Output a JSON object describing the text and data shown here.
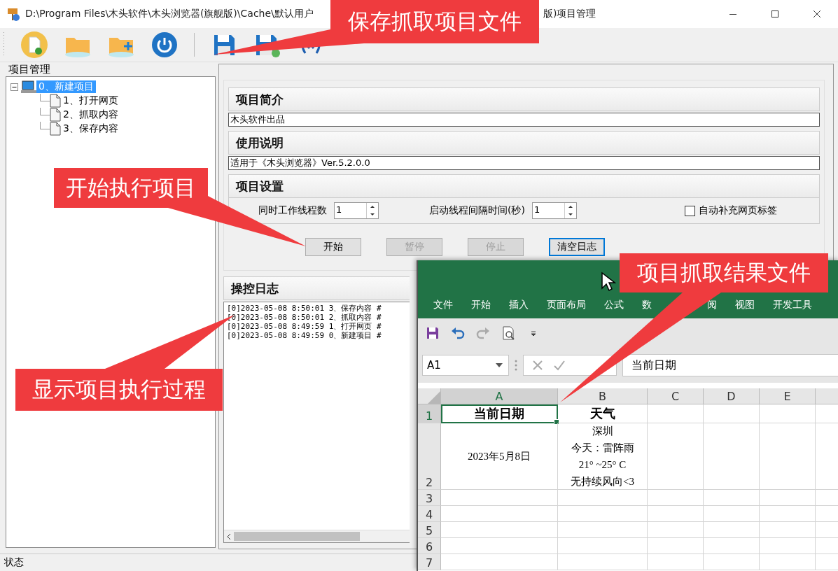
{
  "window": {
    "title_start": "D:\\Program Files\\木头软件\\木头浏览器(旗舰版)\\Cache\\默认用户",
    "title_end": "版)项目管理"
  },
  "project_panel": {
    "title": "项目管理",
    "tree": [
      {
        "label": "0、新建项目",
        "selected": true,
        "expanded": true,
        "children": [
          {
            "label": "1、打开网页",
            "selected": false
          },
          {
            "label": "2、抓取内容",
            "selected": false
          },
          {
            "label": "3、保存内容",
            "selected": false
          }
        ]
      }
    ]
  },
  "sections": [
    {
      "title": "项目简介",
      "value": "木头软件出品"
    },
    {
      "title": "使用说明",
      "value": "适用于《木头浏览器》Ver.5.2.0.0"
    }
  ],
  "settings": {
    "title": "项目设置",
    "thread_count": {
      "label": "同时工作线程数",
      "value": "1"
    },
    "interval": {
      "label": "启动线程间隔时间(秒)",
      "value": "1"
    },
    "auto_tab": {
      "label": "自动补充网页标签",
      "checked": false
    }
  },
  "buttons": [
    {
      "label": "开始",
      "disabled": false,
      "focused": false
    },
    {
      "label": "暂停",
      "disabled": true,
      "focused": false
    },
    {
      "label": "停止",
      "disabled": true,
      "focused": false
    },
    {
      "label": "清空日志",
      "disabled": false,
      "focused": true
    }
  ],
  "log": {
    "title": "操控日志",
    "lines": [
      "[0]2023-05-08 8:50:01 3、保存内容 #",
      "[0]2023-05-08 8:50:01 2、抓取内容 #",
      "[0]2023-05-08 8:49:59 1、打开网页 #",
      "[0]2023-05-08 8:49:59 0、新建项目 #"
    ]
  },
  "status_bar": "状态",
  "excel": {
    "tabs": [
      "文件",
      "开始",
      "插入",
      "页面布局",
      "公式",
      "数",
      "阅",
      "视图",
      "开发工具"
    ],
    "name_box": "A1",
    "formula": "当前日期",
    "columns": [
      {
        "label": "A",
        "selected": true
      },
      {
        "label": "B",
        "selected": false
      },
      {
        "label": "C",
        "selected": false
      },
      {
        "label": "D",
        "selected": false
      },
      {
        "label": "E",
        "selected": false
      }
    ],
    "rows": [
      {
        "header": "1",
        "selected": true,
        "cells": [
          {
            "lines": [
              "当前日期"
            ],
            "selected": true,
            "bold": true
          },
          {
            "lines": [
              "天气"
            ],
            "selected": false,
            "bold": true
          }
        ]
      },
      {
        "header": "2",
        "selected": false,
        "cells": [
          {
            "lines": [
              "2023年5月8日"
            ],
            "selected": false,
            "bold": false
          },
          {
            "lines": [
              "深圳",
              "今天：雷阵雨",
              "21° ~25° C",
              "无持续风向<3"
            ],
            "selected": false,
            "bold": false
          }
        ]
      },
      {
        "header": "3",
        "selected": false
      },
      {
        "header": "4",
        "selected": false
      },
      {
        "header": "5",
        "selected": false
      },
      {
        "header": "6",
        "selected": false
      },
      {
        "header": "7",
        "selected": false
      }
    ]
  },
  "callouts": [
    {
      "text": "保存抓取项目文件"
    },
    {
      "text": "开始执行项目"
    },
    {
      "text": "显示项目执行过程"
    },
    {
      "text": "项目抓取结果文件"
    }
  ]
}
